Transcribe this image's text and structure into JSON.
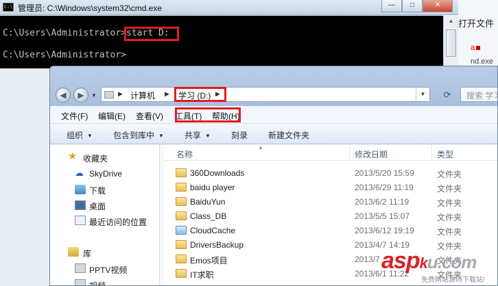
{
  "background_window": {
    "text": "打开文件",
    "red_text": "a",
    "exe_text": "nd.exe"
  },
  "cmd": {
    "title": "管理员: C:\\Windows\\system32\\cmd.exe",
    "line1_prompt": "C:\\Users\\Administrator>",
    "line1_command": "start D:",
    "line2_prompt": "C:\\Users\\Administrator>",
    "minimize_glyph": "—",
    "maximize_glyph": "□",
    "close_glyph": "✕"
  },
  "explorer": {
    "breadcrumb": [
      "计算机",
      "学习 (D:)"
    ],
    "search_placeholder": "搜索 学习 (D:)",
    "menu": [
      "文件(F)",
      "编辑(E)",
      "查看(V)",
      "工具(T)",
      "帮助(H)"
    ],
    "toolbar": [
      "组织",
      "包含到库中",
      "共享",
      "刻录",
      "新建文件夹"
    ],
    "nav_pane": {
      "favorites": "收藏夹",
      "skydrive": "SkyDrive",
      "downloads": "下载",
      "desktop": "桌面",
      "recent": "最近访问的位置",
      "libraries": "库",
      "pptv": "PPTV视频",
      "videos": "视频"
    },
    "columns": {
      "name": "名称",
      "date": "修改日期",
      "type": "类型"
    },
    "files": [
      {
        "name": "360Downloads",
        "date": "2013/5/20 15:59",
        "type": "文件夹",
        "icon": "folder-icon"
      },
      {
        "name": "baidu player",
        "date": "2013/6/29 11:19",
        "type": "文件夹",
        "icon": "folder-icon"
      },
      {
        "name": "BaiduYun",
        "date": "2013/6/2 11:19",
        "type": "文件夹",
        "icon": "folder-icon"
      },
      {
        "name": "Class_DB",
        "date": "2013/5/5 15:07",
        "type": "文件夹",
        "icon": "folder-icon"
      },
      {
        "name": "CloudCache",
        "date": "2013/6/12 19:19",
        "type": "文件夹",
        "icon": "sync-folder-icon"
      },
      {
        "name": "DriversBackup",
        "date": "2013/4/7 14:19",
        "type": "文件夹",
        "icon": "folder-icon"
      },
      {
        "name": "Emos项目",
        "date": "2013/7",
        "type": "文件夹",
        "icon": "folder-icon"
      },
      {
        "name": "IT求职",
        "date": "2013/6/1 11:22",
        "type": "文件夹",
        "icon": "folder-icon"
      }
    ]
  },
  "watermark": {
    "brand": "asp",
    "mid": "k",
    "tail": "u.com",
    "sub": "免费网站源码下载站!"
  },
  "colors": {
    "highlight_red": "#e31b23",
    "console_bg": "#000000",
    "console_text": "#c0c0c0"
  }
}
